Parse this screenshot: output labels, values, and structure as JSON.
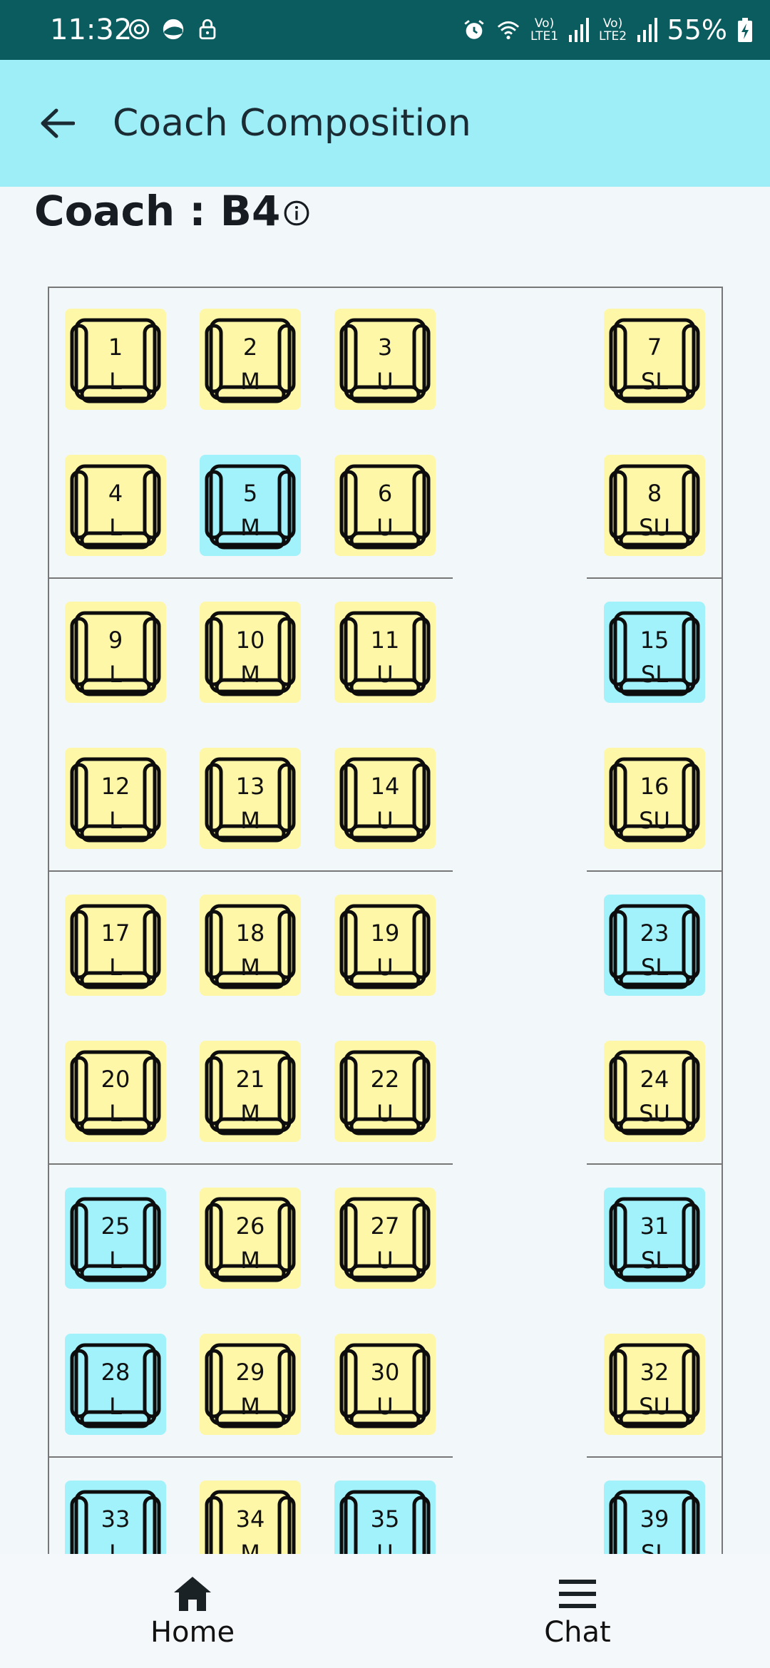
{
  "status_bar": {
    "time": "11:32",
    "battery": "55%",
    "left_icons": [
      "sync-icon",
      "data-saver-icon",
      "lock-icon"
    ],
    "right_icons": [
      "alarm-icon",
      "wifi-icon",
      "signal-sim1-icon",
      "signal-sim2-icon",
      "battery-charging-icon"
    ],
    "sim1_label": "Vo) LTE1",
    "sim2_label": "Vo) LTE2"
  },
  "app_bar": {
    "title": "Coach Composition",
    "back_icon": "arrow-back-icon"
  },
  "coach": {
    "label": "Coach : B4",
    "info_icon": "info-icon"
  },
  "colors": {
    "status_bar": "#0b5c5e",
    "app_bar": "#9eeef7",
    "berth_yellow": "#fff7a8",
    "berth_cyan": "#a1f2fa"
  },
  "berths": [
    {
      "num": "1",
      "type": "L",
      "color": "yellow"
    },
    {
      "num": "2",
      "type": "M",
      "color": "yellow"
    },
    {
      "num": "3",
      "type": "U",
      "color": "yellow"
    },
    {
      "num": "7",
      "type": "SL",
      "color": "yellow"
    },
    {
      "num": "4",
      "type": "L",
      "color": "yellow"
    },
    {
      "num": "5",
      "type": "M",
      "color": "cyan"
    },
    {
      "num": "6",
      "type": "U",
      "color": "yellow"
    },
    {
      "num": "8",
      "type": "SU",
      "color": "yellow"
    },
    {
      "num": "9",
      "type": "L",
      "color": "yellow"
    },
    {
      "num": "10",
      "type": "M",
      "color": "yellow"
    },
    {
      "num": "11",
      "type": "U",
      "color": "yellow"
    },
    {
      "num": "15",
      "type": "SL",
      "color": "cyan"
    },
    {
      "num": "12",
      "type": "L",
      "color": "yellow"
    },
    {
      "num": "13",
      "type": "M",
      "color": "yellow"
    },
    {
      "num": "14",
      "type": "U",
      "color": "yellow"
    },
    {
      "num": "16",
      "type": "SU",
      "color": "yellow"
    },
    {
      "num": "17",
      "type": "L",
      "color": "yellow"
    },
    {
      "num": "18",
      "type": "M",
      "color": "yellow"
    },
    {
      "num": "19",
      "type": "U",
      "color": "yellow"
    },
    {
      "num": "23",
      "type": "SL",
      "color": "cyan"
    },
    {
      "num": "20",
      "type": "L",
      "color": "yellow"
    },
    {
      "num": "21",
      "type": "M",
      "color": "yellow"
    },
    {
      "num": "22",
      "type": "U",
      "color": "yellow"
    },
    {
      "num": "24",
      "type": "SU",
      "color": "yellow"
    },
    {
      "num": "25",
      "type": "L",
      "color": "cyan"
    },
    {
      "num": "26",
      "type": "M",
      "color": "yellow"
    },
    {
      "num": "27",
      "type": "U",
      "color": "yellow"
    },
    {
      "num": "31",
      "type": "SL",
      "color": "cyan"
    },
    {
      "num": "28",
      "type": "L",
      "color": "cyan"
    },
    {
      "num": "29",
      "type": "M",
      "color": "yellow"
    },
    {
      "num": "30",
      "type": "U",
      "color": "yellow"
    },
    {
      "num": "32",
      "type": "SU",
      "color": "yellow"
    },
    {
      "num": "33",
      "type": "L",
      "color": "cyan"
    },
    {
      "num": "34",
      "type": "M",
      "color": "yellow"
    },
    {
      "num": "35",
      "type": "U",
      "color": "cyan"
    },
    {
      "num": "39",
      "type": "SL",
      "color": "cyan"
    }
  ],
  "bottom_nav": {
    "items": [
      {
        "label": "Home",
        "icon": "home-icon"
      },
      {
        "label": "Chat",
        "icon": "menu-icon"
      }
    ]
  }
}
